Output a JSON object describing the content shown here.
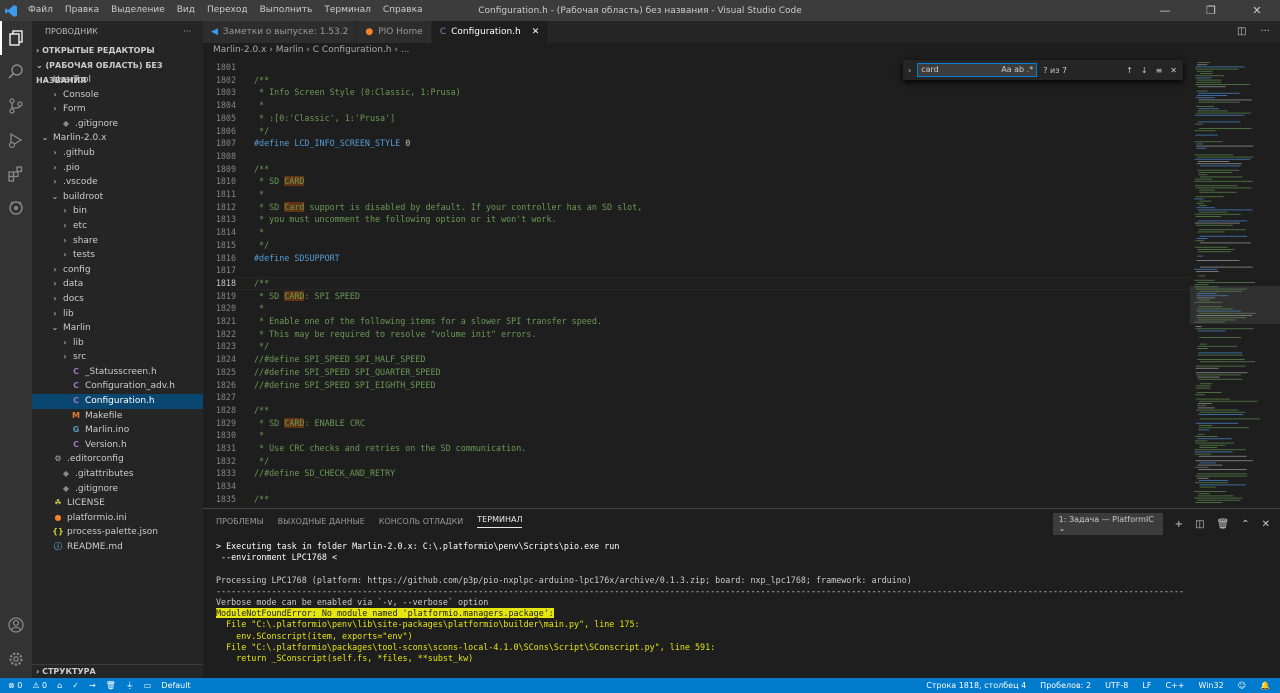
{
  "window": {
    "title": "Configuration.h - (Рабочая область) без названия - Visual Studio Code",
    "controls": [
      "—",
      "❐",
      "✕"
    ]
  },
  "menu": [
    "Файл",
    "Правка",
    "Выделение",
    "Вид",
    "Переход",
    "Выполнить",
    "Терминал",
    "Справка"
  ],
  "sidebar": {
    "title": "ПРОВОДНИК",
    "more": "···",
    "open_editors": "ОТКРЫТЫЕ РЕДАКТОРЫ",
    "workspace": "(РАБОЧАЯ ОБЛАСТЬ) БЕЗ НАЗВАНИЯ",
    "outline": "СТРУКТУРА",
    "items": [
      {
        "label": "UserTool",
        "chev": "⌄",
        "icon": "",
        "color": "",
        "indent": 8
      },
      {
        "label": "Console",
        "chev": "›",
        "icon": "",
        "color": "",
        "indent": 18
      },
      {
        "label": "Form",
        "chev": "›",
        "icon": "",
        "color": "",
        "indent": 18
      },
      {
        "label": ".gitignore",
        "chev": "",
        "icon": "◆",
        "color": "#8a8a8a",
        "indent": 18
      },
      {
        "label": "Marlin-2.0.x",
        "chev": "⌄",
        "icon": "",
        "color": "",
        "indent": 8
      },
      {
        "label": ".github",
        "chev": "›",
        "icon": "",
        "color": "",
        "indent": 18
      },
      {
        "label": ".pio",
        "chev": "›",
        "icon": "",
        "color": "",
        "indent": 18
      },
      {
        "label": ".vscode",
        "chev": "›",
        "icon": "",
        "color": "",
        "indent": 18
      },
      {
        "label": "buildroot",
        "chev": "⌄",
        "icon": "",
        "color": "",
        "indent": 18
      },
      {
        "label": "bin",
        "chev": "›",
        "icon": "",
        "color": "",
        "indent": 28
      },
      {
        "label": "etc",
        "chev": "›",
        "icon": "",
        "color": "",
        "indent": 28
      },
      {
        "label": "share",
        "chev": "›",
        "icon": "",
        "color": "",
        "indent": 28
      },
      {
        "label": "tests",
        "chev": "›",
        "icon": "",
        "color": "",
        "indent": 28
      },
      {
        "label": "config",
        "chev": "›",
        "icon": "",
        "color": "",
        "indent": 18
      },
      {
        "label": "data",
        "chev": "›",
        "icon": "",
        "color": "",
        "indent": 18
      },
      {
        "label": "docs",
        "chev": "›",
        "icon": "",
        "color": "",
        "indent": 18
      },
      {
        "label": "lib",
        "chev": "›",
        "icon": "",
        "color": "",
        "indent": 18
      },
      {
        "label": "Marlin",
        "chev": "⌄",
        "icon": "",
        "color": "",
        "indent": 18
      },
      {
        "label": "lib",
        "chev": "›",
        "icon": "",
        "color": "",
        "indent": 28
      },
      {
        "label": "src",
        "chev": "›",
        "icon": "",
        "color": "",
        "indent": 28
      },
      {
        "label": "_Statusscreen.h",
        "chev": "",
        "icon": "C",
        "color": "#a074c4",
        "indent": 28
      },
      {
        "label": "Configuration_adv.h",
        "chev": "",
        "icon": "C",
        "color": "#a074c4",
        "indent": 28
      },
      {
        "label": "Configuration.h",
        "chev": "",
        "icon": "C",
        "color": "#a074c4",
        "indent": 28,
        "selected": true
      },
      {
        "label": "Makefile",
        "chev": "",
        "icon": "M",
        "color": "#e37933",
        "indent": 28
      },
      {
        "label": "Marlin.ino",
        "chev": "",
        "icon": "G",
        "color": "#519aba",
        "indent": 28
      },
      {
        "label": "Version.h",
        "chev": "",
        "icon": "C",
        "color": "#a074c4",
        "indent": 28
      },
      {
        "label": ".editorconfig",
        "chev": "",
        "icon": "⚙",
        "color": "#aaa",
        "indent": 10
      },
      {
        "label": ".gitattributes",
        "chev": "",
        "icon": "◆",
        "color": "#8a8a8a",
        "indent": 18
      },
      {
        "label": ".gitignore",
        "chev": "",
        "icon": "◆",
        "color": "#8a8a8a",
        "indent": 18
      },
      {
        "label": "LICENSE",
        "chev": "",
        "icon": "☘",
        "color": "#cbcb41",
        "indent": 10
      },
      {
        "label": "platformio.ini",
        "chev": "",
        "icon": "●",
        "color": "#f5822a",
        "indent": 10
      },
      {
        "label": "process-palette.json",
        "chev": "",
        "icon": "{}",
        "color": "#cbcb41",
        "indent": 10
      },
      {
        "label": "README.md",
        "chev": "",
        "icon": "ⓘ",
        "color": "#519aba",
        "indent": 10
      }
    ]
  },
  "tabs": [
    {
      "label": "Заметки о выпуске: 1.53.2",
      "icon": "◀",
      "color": "#3b9bf0"
    },
    {
      "label": "PIO Home",
      "icon": "●",
      "color": "#f5822a"
    },
    {
      "label": "Configuration.h",
      "icon": "C",
      "color": "#a074c4",
      "active": true,
      "close": "✕"
    }
  ],
  "breadcrumb": "Marlin-2.0.x  ›  Marlin  ›  C  Configuration.h  ›  ...",
  "find": {
    "value": "card",
    "case": "Aa",
    "word": "ab",
    "regex": ".*",
    "result": "? из 7",
    "up": "↑",
    "down": "↓",
    "sel": "≡",
    "close": "✕"
  },
  "code_lines": [
    {
      "n": "1801",
      "t": ""
    },
    {
      "n": "1802",
      "t": "/**",
      "c": "cm"
    },
    {
      "n": "1803",
      "t": " * Info Screen Style (0:Classic, 1:Prusa)",
      "c": "cm"
    },
    {
      "n": "1804",
      "t": " *",
      "c": "cm"
    },
    {
      "n": "1805",
      "t": " * :[0:'Classic', 1:'Prusa']",
      "c": "cm"
    },
    {
      "n": "1806",
      "t": " */",
      "c": "cm"
    },
    {
      "n": "1807",
      "pre": "#define ",
      "mac": "LCD_INFO_SCREEN_STYLE ",
      "num": "0"
    },
    {
      "n": "1808",
      "t": ""
    },
    {
      "n": "1809",
      "t": "/**",
      "c": "cm"
    },
    {
      "n": "1810",
      "t": " * SD ",
      "c": "cm",
      "hl": "CARD"
    },
    {
      "n": "1811",
      "t": " *",
      "c": "cm"
    },
    {
      "n": "1812",
      "t": " * SD ",
      "c": "cm",
      "hl": "Card",
      "after": " support is disabled by default. If your controller has an SD slot,"
    },
    {
      "n": "1813",
      "t": " * you must uncomment the following option or it won't work.",
      "c": "cm"
    },
    {
      "n": "1814",
      "t": " *",
      "c": "cm"
    },
    {
      "n": "1815",
      "t": " */",
      "c": "cm"
    },
    {
      "n": "1816",
      "pre": "#define ",
      "mac": "SDSUPPORT"
    },
    {
      "n": "1817",
      "t": ""
    },
    {
      "n": "1818",
      "t": "/**",
      "c": "cm",
      "cur": true
    },
    {
      "n": "1819",
      "t": " * SD ",
      "c": "cm",
      "hl": "CARD",
      "after": ": SPI SPEED"
    },
    {
      "n": "1820",
      "t": " *",
      "c": "cm"
    },
    {
      "n": "1821",
      "t": " * Enable one of the following items for a slower SPI transfer speed.",
      "c": "cm"
    },
    {
      "n": "1822",
      "t": " * This may be required to resolve \"volume init\" errors.",
      "c": "cm"
    },
    {
      "n": "1823",
      "t": " */",
      "c": "cm"
    },
    {
      "n": "1824",
      "t": "//#define SPI_SPEED SPI_HALF_SPEED",
      "c": "cm"
    },
    {
      "n": "1825",
      "t": "//#define SPI_SPEED SPI_QUARTER_SPEED",
      "c": "cm"
    },
    {
      "n": "1826",
      "t": "//#define SPI_SPEED SPI_EIGHTH_SPEED",
      "c": "cm"
    },
    {
      "n": "1827",
      "t": ""
    },
    {
      "n": "1828",
      "t": "/**",
      "c": "cm"
    },
    {
      "n": "1829",
      "t": " * SD ",
      "c": "cm",
      "hl": "CARD",
      "after": ": ENABLE CRC"
    },
    {
      "n": "1830",
      "t": " *",
      "c": "cm"
    },
    {
      "n": "1831",
      "t": " * Use CRC checks and retries on the SD communication.",
      "c": "cm"
    },
    {
      "n": "1832",
      "t": " */",
      "c": "cm"
    },
    {
      "n": "1833",
      "t": "//#define SD_CHECK_AND_RETRY",
      "c": "cm"
    },
    {
      "n": "1834",
      "t": ""
    },
    {
      "n": "1835",
      "t": "/**",
      "c": "cm"
    }
  ],
  "panel": {
    "tabs": [
      "ПРОБЛЕМЫ",
      "ВЫХОДНЫЕ ДАННЫЕ",
      "КОНСОЛЬ ОТЛАДКИ",
      "ТЕРМИНАЛ"
    ],
    "task": "1: Задача — PlatformIC ⌄",
    "lines": [
      {
        "t": "> Executing task in folder Marlin-2.0.x: C:\\.platformio\\penv\\Scripts\\pio.exe run",
        "c": "#fff"
      },
      {
        "t": " --environment LPC1768 <",
        "c": "#fff"
      },
      {
        "t": "",
        "c": "#ccc"
      },
      {
        "t": "Processing LPC1768 (platform: https://github.com/p3p/pio-nxplpc-arduino-lpc176x/archive/0.1.3.zip; board: nxp_lpc1768; framework: arduino)",
        "c": "#ccc"
      },
      {
        "t": "------------------------------------------------------------------------------------------------------------------------------------------------------------------------------------------------",
        "c": "#ccc"
      },
      {
        "t": "Verbose mode can be enabled via `-v, --verbose` option",
        "c": "#ccc"
      },
      {
        "t": "ModuleNotFoundError: No module named 'platformio.managers.package':",
        "c": "#1e1e1e",
        "bg": "#e5e510"
      },
      {
        "t": "  File \"C:\\.platformio\\penv\\lib\\site-packages\\platformio\\builder\\main.py\", line 175:",
        "c": "#e5e510"
      },
      {
        "t": "    env.SConscript(item, exports=\"env\")",
        "c": "#e5e510"
      },
      {
        "t": "  File \"C:\\.platformio\\packages\\tool-scons\\scons-local-4.1.0\\SCons\\Script\\SConscript.py\", line 591:",
        "c": "#e5e510"
      },
      {
        "t": "    return _SConscript(self.fs, *files, **subst_kw)",
        "c": "#e5e510"
      }
    ]
  },
  "status": {
    "errors": "⊗ 0",
    "warnings": "⚠ 0",
    "env": "Default",
    "position": "Строка 1818, столбец 4",
    "spaces": "Пробелов: 2",
    "encoding": "UTF-8",
    "eol": "LF",
    "lang": "C++",
    "platform": "Win32"
  }
}
